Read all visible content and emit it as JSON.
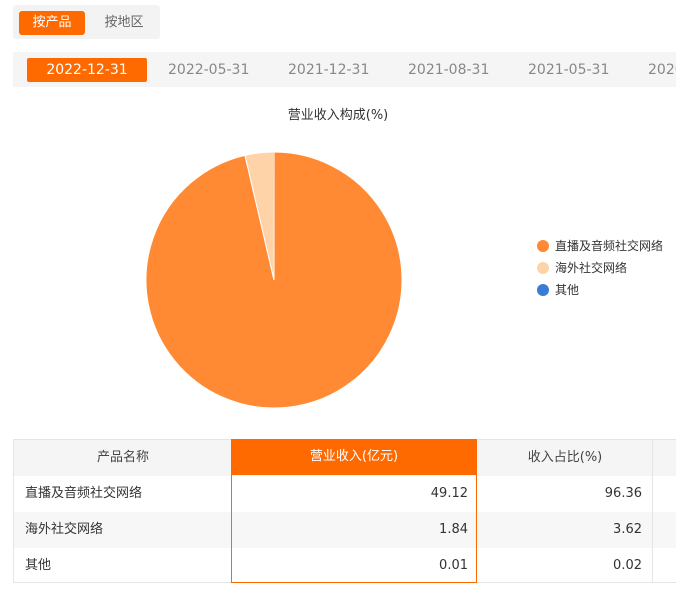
{
  "toggle": {
    "product_label": "按产品",
    "region_label": "按地区"
  },
  "dates": [
    "2022-12-31",
    "2022-05-31",
    "2021-12-31",
    "2021-08-31",
    "2021-05-31",
    "2020"
  ],
  "chart_data": {
    "type": "pie",
    "title": "营业收入构成(%)",
    "categories": [
      "直播及音频社交网络",
      "海外社交网络",
      "其他"
    ],
    "values": [
      96.36,
      3.62,
      0.02
    ],
    "colors": [
      "#ff8a33",
      "#ffd3a8",
      "#3a7bd5"
    ],
    "legend_position": "right"
  },
  "table": {
    "headers": [
      "产品名称",
      "营业收入(亿元)",
      "收入占比(%)"
    ],
    "rows": [
      [
        "直播及音频社交网络",
        "49.12",
        "96.36"
      ],
      [
        "海外社交网络",
        "1.84",
        "3.62"
      ],
      [
        "其他",
        "0.01",
        "0.02"
      ]
    ]
  }
}
